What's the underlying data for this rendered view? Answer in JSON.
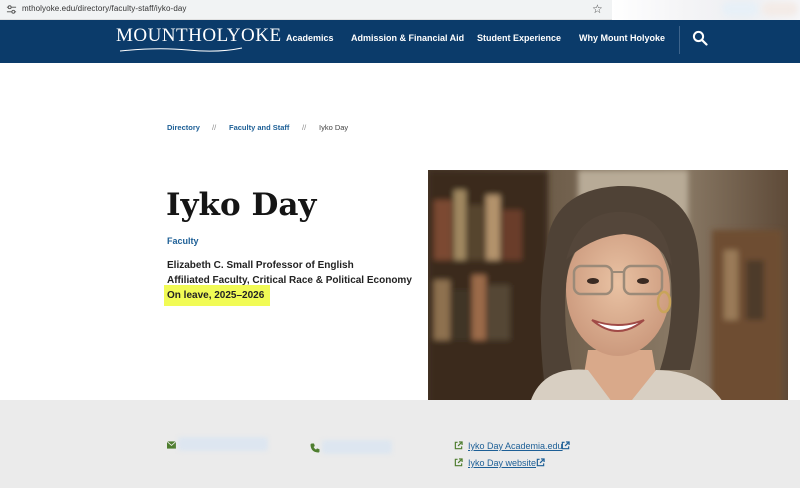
{
  "browser": {
    "url": "mtholyoke.edu/directory/faculty-staff/iyko-day"
  },
  "header": {
    "logo_text": "MOUNTHOLYOKE",
    "nav": [
      "Academics",
      "Admission & Financial Aid",
      "Student Experience",
      "Why Mount Holyoke"
    ]
  },
  "breadcrumb": {
    "items": [
      "Directory",
      "Faculty and Staff",
      "Iyko Day"
    ],
    "separator": "//"
  },
  "profile": {
    "name": "Iyko Day",
    "type": "Faculty",
    "titles": [
      "Elizabeth C. Small Professor of English",
      "Affiliated Faculty, Critical Race & Political Economy",
      "On leave, 2025–2026"
    ]
  },
  "links": [
    "Iyko Day Academia.edu",
    "Iyko Day website"
  ],
  "colors": {
    "header_bg": "#0b3b6a",
    "link": "#1d5f96",
    "highlight": "#f1fb55",
    "footer_bg": "#ebebeb",
    "contact_icon": "#4e7d2e"
  }
}
